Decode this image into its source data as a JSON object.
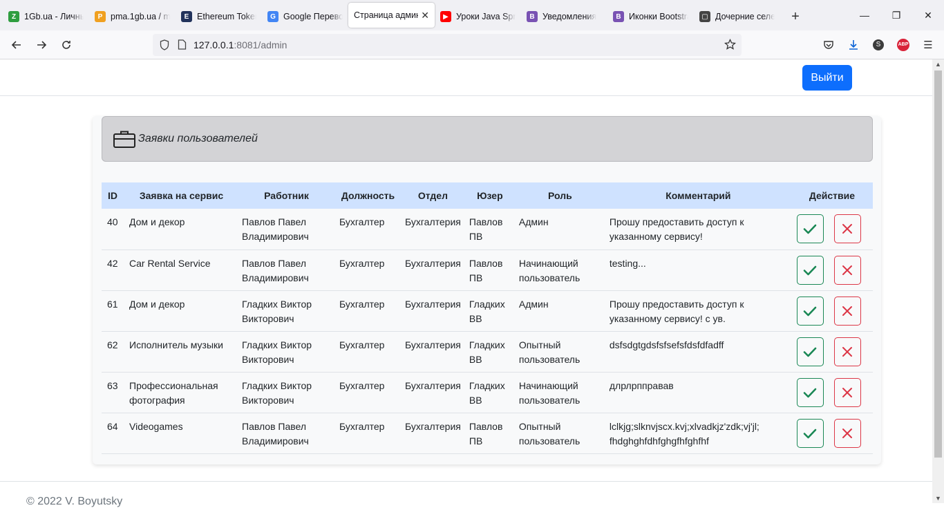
{
  "browser": {
    "tabs": [
      {
        "title": "1Gb.ua - Личны",
        "fav": "1gb-favicon-icon",
        "color": "#2e9d3f",
        "glyph": "Z"
      },
      {
        "title": "pma.1gb.ua / m",
        "fav": "pma-favicon-icon",
        "color": "#f0a020",
        "glyph": "P"
      },
      {
        "title": "Ethereum Token",
        "fav": "etherscan-favicon-icon",
        "color": "#21325b",
        "glyph": "E"
      },
      {
        "title": "Google Перевод",
        "fav": "google-translate-icon",
        "color": "#4285f4",
        "glyph": "G"
      },
      {
        "title": "Страница админ",
        "fav": "",
        "color": "",
        "glyph": "",
        "active": true
      },
      {
        "title": "Уроки Java Spri",
        "fav": "youtube-icon",
        "color": "#ff0000",
        "glyph": "▶"
      },
      {
        "title": "Уведомления",
        "fav": "bootstrap-icon",
        "color": "#7952b3",
        "glyph": "B"
      },
      {
        "title": "Иконки Bootstra",
        "fav": "bootstrap-icon",
        "color": "#7952b3",
        "glyph": "B"
      },
      {
        "title": "Дочерние селе",
        "fav": "comment-icon",
        "color": "#444",
        "glyph": "▢"
      }
    ],
    "url_host": "127.0.0.1",
    "url_rest": ":8081/admin"
  },
  "header": {
    "logout_label": "Выйти"
  },
  "card": {
    "title": "Заявки пользователей"
  },
  "table": {
    "headers": [
      "ID",
      "Заявка на сервис",
      "Работник",
      "Должность",
      "Отдел",
      "Юзер",
      "Роль",
      "Комментарий",
      "Действие"
    ],
    "rows": [
      {
        "id": "40",
        "service": "Дом и декор",
        "worker": "Павлов Павел Владимирович",
        "position": "Бухгалтер",
        "dept": "Бухгалтерия",
        "user": "Павлов ПВ",
        "role": "Админ",
        "comment": "Прошу предоставить доступ к указанному сервису!"
      },
      {
        "id": "42",
        "service": "Car Rental Service",
        "worker": "Павлов Павел Владимирович",
        "position": "Бухгалтер",
        "dept": "Бухгалтерия",
        "user": "Павлов ПВ",
        "role": "Начинающий пользователь",
        "comment": "testing..."
      },
      {
        "id": "61",
        "service": "Дом и декор",
        "worker": "Гладких Виктор Викторович",
        "position": "Бухгалтер",
        "dept": "Бухгалтерия",
        "user": "Гладких ВВ",
        "role": "Админ",
        "comment": "Прошу предоставить доступ к указанному сервису! с ув."
      },
      {
        "id": "62",
        "service": "Исполнитель музыки",
        "worker": "Гладких Виктор Викторович",
        "position": "Бухгалтер",
        "dept": "Бухгалтерия",
        "user": "Гладких ВВ",
        "role": "Опытный пользователь",
        "comment": "dsfsdgtgdsfsfsefsfdsfdfadff"
      },
      {
        "id": "63",
        "service": "Профессиональная фотография",
        "worker": "Гладких Виктор Викторович",
        "position": "Бухгалтер",
        "dept": "Бухгалтерия",
        "user": "Гладких ВВ",
        "role": "Начинающий пользователь",
        "comment": "длрлрпправав"
      },
      {
        "id": "64",
        "service": "Videogames",
        "worker": "Павлов Павел Владимирович",
        "position": "Бухгалтер",
        "dept": "Бухгалтерия",
        "user": "Павлов ПВ",
        "role": "Опытный пользователь",
        "comment": "lclkjg;slknvjscx.kvj;xlvadkjz'zdk;vj'jl; fhdghghfdhfghgfhfghfhf"
      }
    ]
  },
  "footer": {
    "text": "© 2022 V. Boyutsky"
  },
  "colors": {
    "primary": "#0d6efd",
    "success": "#198754",
    "danger": "#dc3545",
    "thead": "#cfe2ff"
  }
}
